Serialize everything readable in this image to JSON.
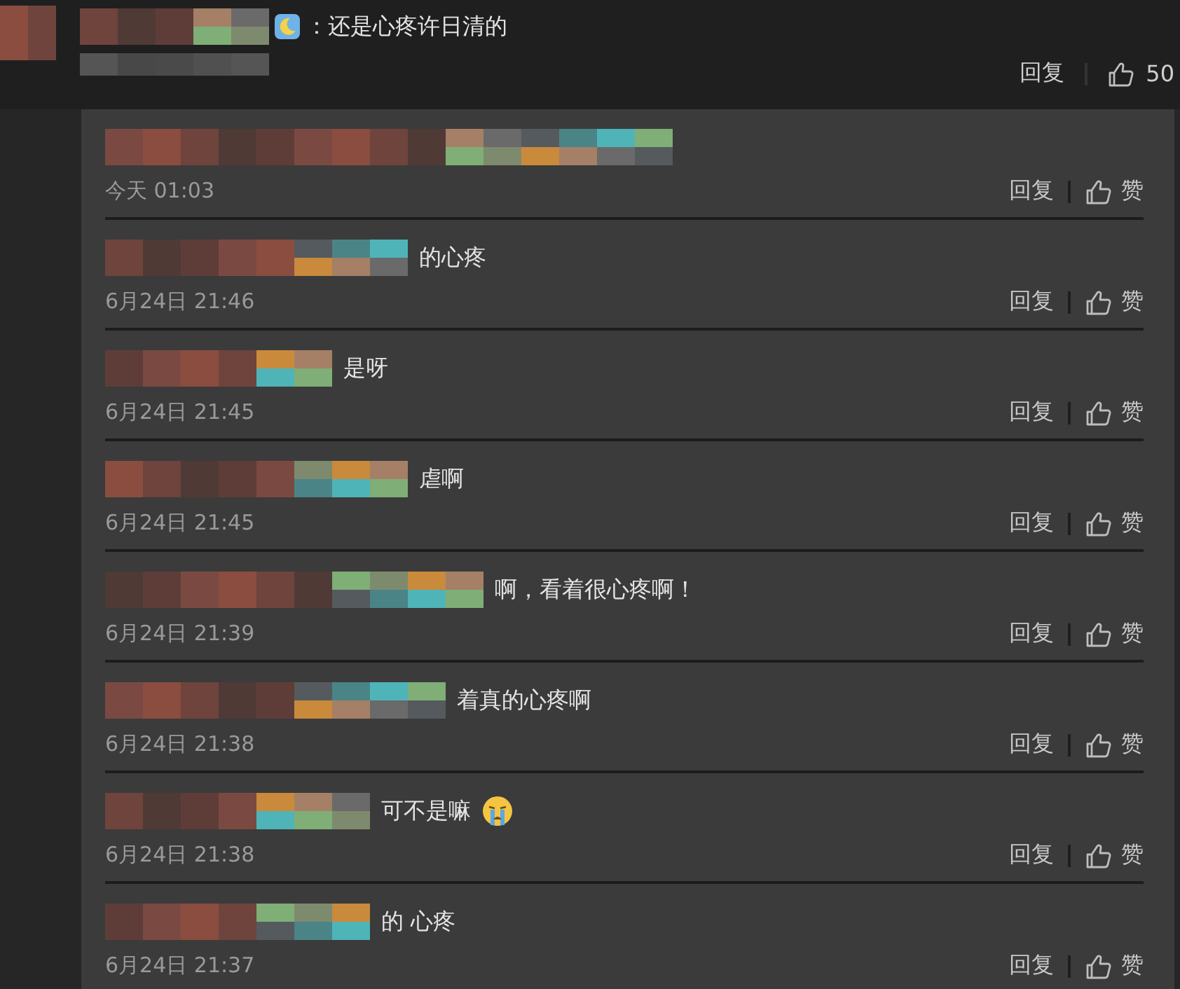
{
  "comment": {
    "badge": true,
    "text": "：还是心疼许日清的",
    "reply_label": "回复",
    "likes": "50"
  },
  "replies": [
    {
      "time": "今天 01:03",
      "reply_label": "回复",
      "like_label": "赞"
    },
    {
      "text": "的心疼",
      "time": "6月24日 21:46",
      "reply_label": "回复",
      "like_label": "赞"
    },
    {
      "text": "是呀",
      "time": "6月24日 21:45",
      "reply_label": "回复",
      "like_label": "赞"
    },
    {
      "text": "虐啊",
      "time": "6月24日 21:45",
      "reply_label": "回复",
      "like_label": "赞"
    },
    {
      "text": "啊，看着很心疼啊！",
      "time": "6月24日 21:39",
      "reply_label": "回复",
      "like_label": "赞"
    },
    {
      "text": "着真的心疼啊",
      "time": "6月24日 21:38",
      "reply_label": "回复",
      "like_label": "赞"
    },
    {
      "text": "可不是嘛",
      "emoji": true,
      "time": "6月24日 21:38",
      "reply_label": "回复",
      "like_label": "赞"
    },
    {
      "text": "的 心疼",
      "time": "6月24日 21:37",
      "reply_label": "回复",
      "like_label": "赞"
    }
  ]
}
